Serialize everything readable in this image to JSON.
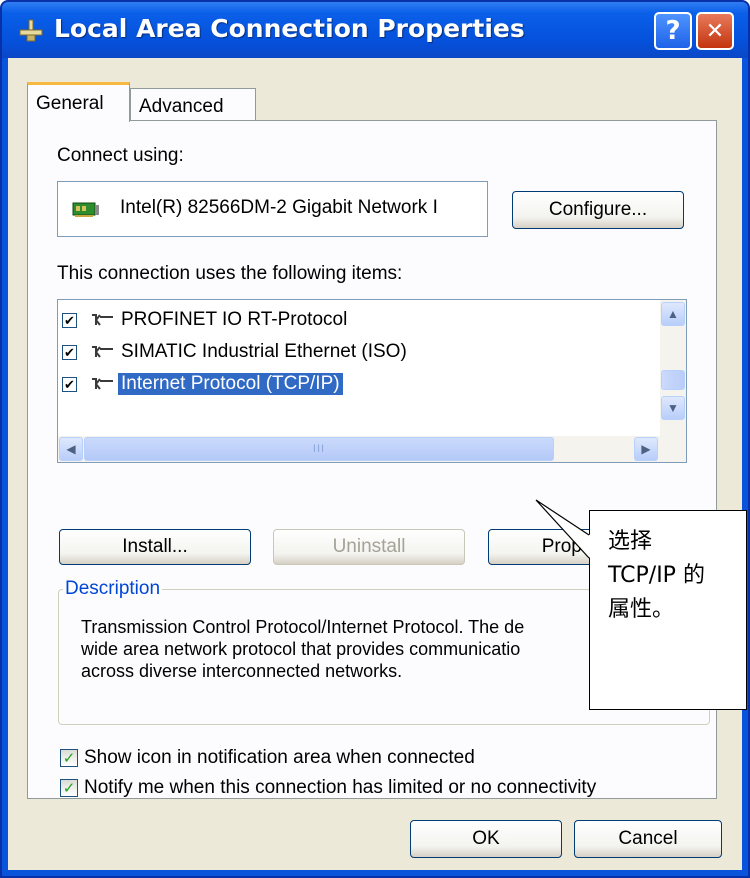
{
  "window": {
    "title": "Local Area Connection Properties",
    "help_glyph": "?",
    "close_glyph": "✕"
  },
  "tabs": [
    {
      "label": "General",
      "active": true
    },
    {
      "label": "Advanced",
      "active": false
    }
  ],
  "connect_using": {
    "label": "Connect using:",
    "adapter": "Intel(R) 82566DM-2 Gigabit Network I",
    "configure_label": "Configure..."
  },
  "items": {
    "label": "This connection uses the following items:",
    "list": [
      {
        "label": "PROFINET IO RT-Protocol",
        "checked": true,
        "selected": false
      },
      {
        "label": "SIMATIC Industrial Ethernet (ISO)",
        "checked": true,
        "selected": false
      },
      {
        "label": "Internet Protocol (TCP/IP)",
        "checked": true,
        "selected": true
      }
    ],
    "scroll_grip": "III"
  },
  "buttons": {
    "install": "Install...",
    "uninstall": "Uninstall",
    "properties": "Properties",
    "ok": "OK",
    "cancel": "Cancel"
  },
  "description": {
    "title": "Description",
    "text": "Transmission Control Protocol/Internet Protocol. The de\nwide area network protocol that provides communicatio\nacross diverse interconnected networks."
  },
  "options": [
    {
      "label": "Show icon in notification area when connected",
      "checked": true
    },
    {
      "label": "Notify me when this connection has limited or no connectivity",
      "checked": true
    }
  ],
  "callout": {
    "text": "选择\nTCP/IP 的\n属性。"
  },
  "colors": {
    "titlebar": "#0a53db",
    "selection": "#316ac5",
    "face": "#ece9d8",
    "group_title": "#0046d5"
  }
}
